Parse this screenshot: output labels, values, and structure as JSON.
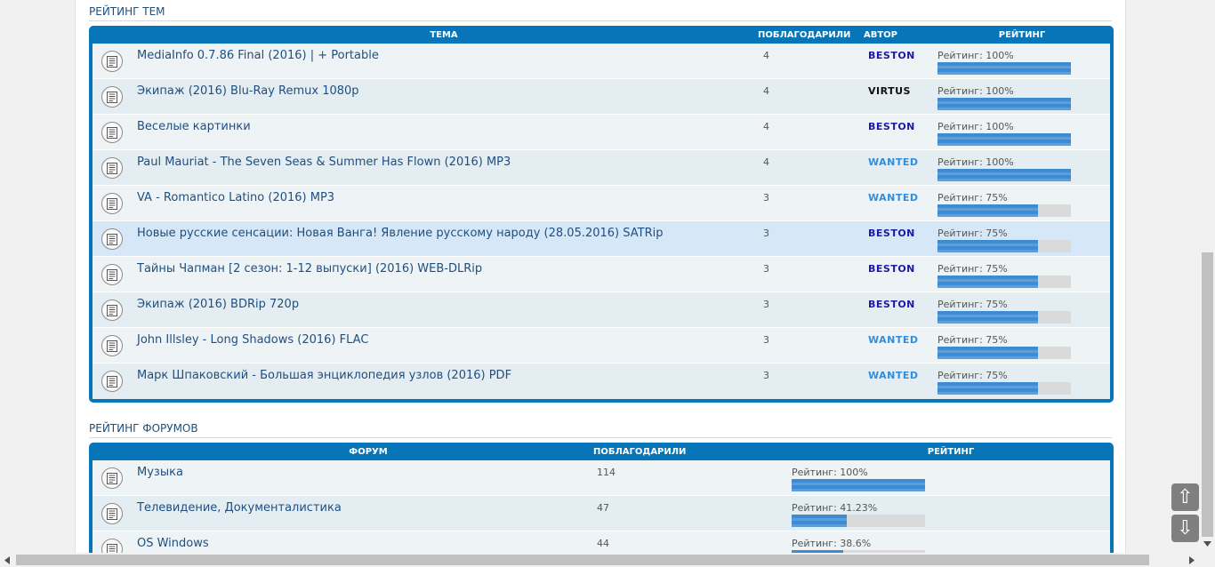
{
  "topics_section": {
    "title": "Рейтинг тем",
    "columns": {
      "topic": "ТЕМА",
      "thanks": "ПОБЛАГОДАРИЛИ",
      "author": "АВТОР",
      "rating": "РЕЙТИНГ"
    },
    "rows": [
      {
        "title": "MediaInfo 0.7.86 Final (2016) | + Portable",
        "thanks": "4",
        "author": "BESTON",
        "author_color": "#1a1aa6",
        "rating_label": "Рейтинг: 100%",
        "rating_pct": 100
      },
      {
        "title": "Экипаж (2016) Blu-Ray Remux 1080p",
        "thanks": "4",
        "author": "VIRTUS",
        "author_color": "#111111",
        "rating_label": "Рейтинг: 100%",
        "rating_pct": 100
      },
      {
        "title": "Веселые картинки",
        "thanks": "4",
        "author": "BESTON",
        "author_color": "#1a1aa6",
        "rating_label": "Рейтинг: 100%",
        "rating_pct": 100
      },
      {
        "title": "Paul Mauriat - The Seven Seas & Summer Has Flown (2016) MP3",
        "thanks": "4",
        "author": "WANTED",
        "author_color": "#2e8ee0",
        "rating_label": "Рейтинг: 100%",
        "rating_pct": 100
      },
      {
        "title": "VA - Romantico Latino (2016) MP3",
        "thanks": "3",
        "author": "WANTED",
        "author_color": "#2e8ee0",
        "rating_label": "Рейтинг: 75%",
        "rating_pct": 75
      },
      {
        "title": "Новые русские сенсации: Новая Ванга! Явление русскому народу (28.05.2016) SATRip",
        "thanks": "3",
        "author": "BESTON",
        "author_color": "#1a1aa6",
        "rating_label": "Рейтинг: 75%",
        "rating_pct": 75,
        "highlight": true
      },
      {
        "title": "Тайны Чапман [2 сезон: 1-12 выпуски] (2016) WEB-DLRip",
        "thanks": "3",
        "author": "BESTON",
        "author_color": "#1a1aa6",
        "rating_label": "Рейтинг: 75%",
        "rating_pct": 75
      },
      {
        "title": "Экипаж (2016) BDRip 720p",
        "thanks": "3",
        "author": "BESTON",
        "author_color": "#1a1aa6",
        "rating_label": "Рейтинг: 75%",
        "rating_pct": 75
      },
      {
        "title": "John Illsley - Long Shadows (2016) FLAC",
        "thanks": "3",
        "author": "WANTED",
        "author_color": "#2e8ee0",
        "rating_label": "Рейтинг: 75%",
        "rating_pct": 75
      },
      {
        "title": "Марк Шпаковский - Большая энциклопедия узлов (2016) PDF",
        "thanks": "3",
        "author": "WANTED",
        "author_color": "#2e8ee0",
        "rating_label": "Рейтинг: 75%",
        "rating_pct": 75
      }
    ]
  },
  "forums_section": {
    "title": "Рейтинг форумов",
    "columns": {
      "forum": "ФОРУМ",
      "thanks": "ПОБЛАГОДАРИЛИ",
      "rating": "РЕЙТИНГ"
    },
    "rows": [
      {
        "title": "Музыка",
        "thanks": "114",
        "rating_label": "Рейтинг: 100%",
        "rating_pct": 100
      },
      {
        "title": "Телевидение, Документалистика",
        "thanks": "47",
        "rating_label": "Рейтинг: 41.23%",
        "rating_pct": 41.23
      },
      {
        "title": "OS Windows",
        "thanks": "44",
        "rating_label": "Рейтинг: 38.6%",
        "rating_pct": 38.6
      }
    ]
  },
  "nav": {
    "up": "⇧",
    "down": "⇩"
  },
  "colors": {
    "panel": "#0875b8",
    "link": "#1f4f80",
    "bar": "#3e8ad3"
  }
}
